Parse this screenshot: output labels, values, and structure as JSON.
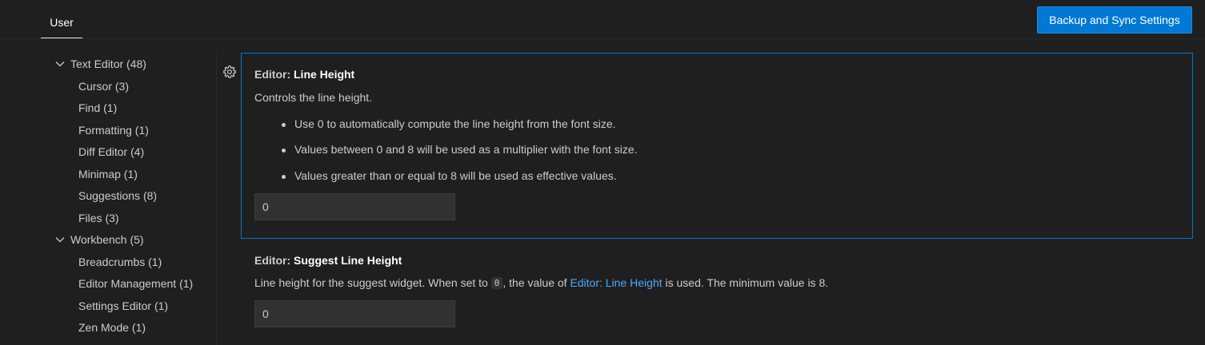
{
  "header": {
    "tab_user": "User",
    "sync_button": "Backup and Sync Settings"
  },
  "tree": {
    "groups": [
      {
        "label": "Text Editor (48)",
        "children": [
          "Cursor (3)",
          "Find (1)",
          "Formatting (1)",
          "Diff Editor (4)",
          "Minimap (1)",
          "Suggestions (8)",
          "Files (3)"
        ]
      },
      {
        "label": "Workbench (5)",
        "children": [
          "Breadcrumbs (1)",
          "Editor Management (1)",
          "Settings Editor (1)",
          "Zen Mode (1)"
        ]
      }
    ]
  },
  "settings": {
    "line_height": {
      "category": "Editor: ",
      "name": "Line Height",
      "description": "Controls the line height.",
      "bullets": [
        "Use 0 to automatically compute the line height from the font size.",
        "Values between 0 and 8 will be used as a multiplier with the font size.",
        "Values greater than or equal to 8 will be used as effective values."
      ],
      "value": "0"
    },
    "suggest_line_height": {
      "category": "Editor: ",
      "name": "Suggest Line Height",
      "description_before": "Line height for the suggest widget. When set to ",
      "code": "0",
      "description_middle": ", the value of ",
      "link": "Editor: Line Height",
      "description_after": " is used. The minimum value is 8.",
      "value": "0"
    }
  },
  "icons": {
    "gear": "gear-icon",
    "chevron": "chevron-down-icon"
  },
  "colors": {
    "background": "#1f1f1f",
    "accent": "#0078d4",
    "link": "#4daafc"
  }
}
